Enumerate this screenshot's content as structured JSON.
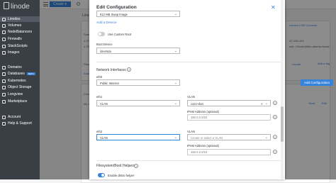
{
  "sidebar": {
    "logo": "linode",
    "items": [
      {
        "label": "Linodes",
        "active": true
      },
      {
        "label": "Volumes"
      },
      {
        "label": "NodeBalancers"
      },
      {
        "label": "Firewalls"
      },
      {
        "label": "StackScripts"
      },
      {
        "label": "Images"
      },
      {
        "label": "Domains"
      },
      {
        "label": "Databases",
        "badge": "BETA"
      },
      {
        "label": "Kubernetes"
      },
      {
        "label": "Object Storage"
      },
      {
        "label": "Longview"
      },
      {
        "label": "Marketplace"
      },
      {
        "label": "Account"
      },
      {
        "label": "Help & Support"
      }
    ]
  },
  "topbar": {
    "create_label": "Create ▾"
  },
  "background": {
    "linode_label": "Linode",
    "summary": "Sum",
    "cpu": "1 CP",
    "memory": "1 GB",
    "plan_label": "Plan",
    "analytics": "Anal",
    "config_label": "Config",
    "my_label": "My C",
    "launch_lish": "Launch LISH Console",
    "ip_text": "AT-158-164",
    "ssh_text": "ssh -t linode@lish-atlanta.linode",
    "longview_tab": "Linode",
    "add_tag": "Add a tag",
    "add_configuration": "Add Configuration",
    "boot": "Boot",
    "edit": "Edit"
  },
  "dialog": {
    "title": "Edit Configuration",
    "top_select_value": "512 MB Swap Image",
    "add_device": "Add a Device",
    "custom_root_label": "Use Custom Root",
    "boot_device_label": "Boot Device",
    "boot_device_value": "/dev/sda",
    "network_title": "Network Interfaces",
    "eth0": {
      "label": "eth0",
      "value": "Public Internet"
    },
    "eth1": {
      "label": "eth1",
      "type_value": "VLAN",
      "vlan_label": "VLAN",
      "vlan_value": "coco-vlan",
      "ipam_label": "IPAM Address (optional)",
      "ipam_placeholder": "192.0.2.0/24"
    },
    "eth2": {
      "label": "eth2",
      "type_value": "VLAN",
      "vlan_label": "VLAN",
      "vlan_placeholder": "Create or select a VLAN",
      "ipam_label": "IPAM Address (optional)",
      "ipam_placeholder": "192.0.2.0/24"
    },
    "filesystem_title": "Filesystem/Boot Helpers",
    "distro_helper_label": "Enable distro helper"
  }
}
